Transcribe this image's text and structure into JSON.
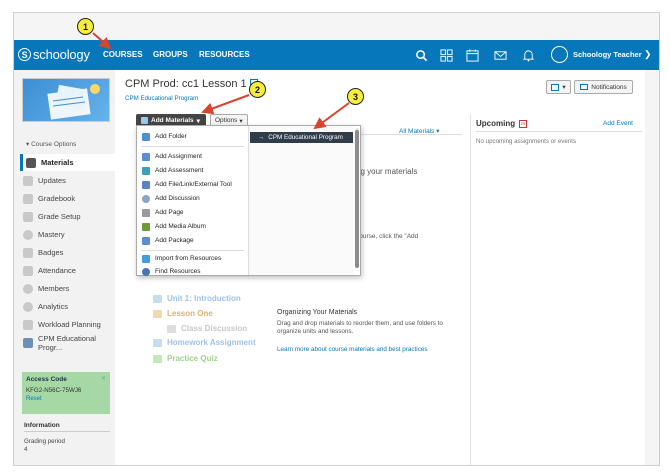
{
  "topbar": {
    "logo": "schoology",
    "nav": [
      "COURSES",
      "GROUPS",
      "RESOURCES"
    ],
    "user": "Schoology Teacher",
    "icons": [
      "search-icon",
      "apps-icon",
      "calendar-icon",
      "messages-icon",
      "notifications-icon"
    ]
  },
  "sidebar": {
    "course_options": "Course Options",
    "items": [
      {
        "label": "Materials",
        "icon": "materials-icon"
      },
      {
        "label": "Updates",
        "icon": "updates-icon"
      },
      {
        "label": "Gradebook",
        "icon": "gradebook-icon"
      },
      {
        "label": "Grade Setup",
        "icon": "grade-setup-icon"
      },
      {
        "label": "Mastery",
        "icon": "mastery-icon"
      },
      {
        "label": "Badges",
        "icon": "badges-icon"
      },
      {
        "label": "Attendance",
        "icon": "attendance-icon"
      },
      {
        "label": "Members",
        "icon": "members-icon"
      },
      {
        "label": "Analytics",
        "icon": "analytics-icon"
      },
      {
        "label": "Workload Planning",
        "icon": "workload-icon"
      },
      {
        "label": "CPM Educational Progr...",
        "icon": "cpm-icon"
      }
    ],
    "access_code": {
      "title": "Access Code",
      "code": "KFG2-N56C-75WJ6",
      "reset": "Reset"
    },
    "information": "Information",
    "grading_period_label": "Grading period",
    "grading_period_value": "4"
  },
  "main": {
    "course_title": "CPM Prod: cc1 Lesson 1",
    "course_subtitle": "CPM Educational Program",
    "notifications_button": "Notifications",
    "add_materials_button": "Add Materials",
    "options_button": "Options",
    "all_materials": "All Materials",
    "hint_heading": "ng your materials",
    "hint_line": "course, click the \"Add",
    "materials": [
      {
        "label": "Unit 1: Introduction",
        "type": "folder"
      },
      {
        "label": "Lesson One",
        "type": "lesson"
      },
      {
        "label": "Class Discussion",
        "type": "discussion"
      },
      {
        "label": "Homework Assignment",
        "type": "folder"
      },
      {
        "label": "Practice Quiz",
        "type": "quiz"
      }
    ],
    "organizing_heading": "Organizing Your Materials",
    "organizing_text": "Drag and drop materials to reorder them, and use folders to organize units and lessons.",
    "organizing_link": "Learn more about course materials and best practices"
  },
  "upcoming": {
    "title": "Upcoming",
    "add_event": "Add Event",
    "empty": "No upcoming assignments or events"
  },
  "dropdown": {
    "items": [
      {
        "label": "Add Folder",
        "icon": "folder-icon",
        "color": "#4f8fcf"
      },
      {
        "label": "Add Assignment",
        "icon": "assignment-icon",
        "color": "#5b8fd0"
      },
      {
        "label": "Add Assessment",
        "icon": "assessment-icon",
        "color": "#3ea0b8"
      },
      {
        "label": "Add File/Link/External Tool",
        "icon": "file-link-icon",
        "color": "#5a83c2"
      },
      {
        "label": "Add Discussion",
        "icon": "discussion-icon",
        "color": "#8aa6c8"
      },
      {
        "label": "Add Page",
        "icon": "page-icon",
        "color": "#9a9a9a"
      },
      {
        "label": "Add Media Album",
        "icon": "media-album-icon",
        "color": "#6c9a3c"
      },
      {
        "label": "Add Package",
        "icon": "package-icon",
        "color": "#5b8fd0"
      },
      {
        "label": "Import from Resources",
        "icon": "import-icon",
        "color": "#3f9fd6"
      },
      {
        "label": "Find Resources",
        "icon": "find-icon",
        "color": "#4a74b8"
      }
    ],
    "resource_item": "CPM Educational Program"
  },
  "callouts": [
    "1",
    "2",
    "3"
  ],
  "colors": {
    "brand": "#0677ba",
    "callout": "#f6ee3a",
    "arrow": "#d8442e"
  }
}
